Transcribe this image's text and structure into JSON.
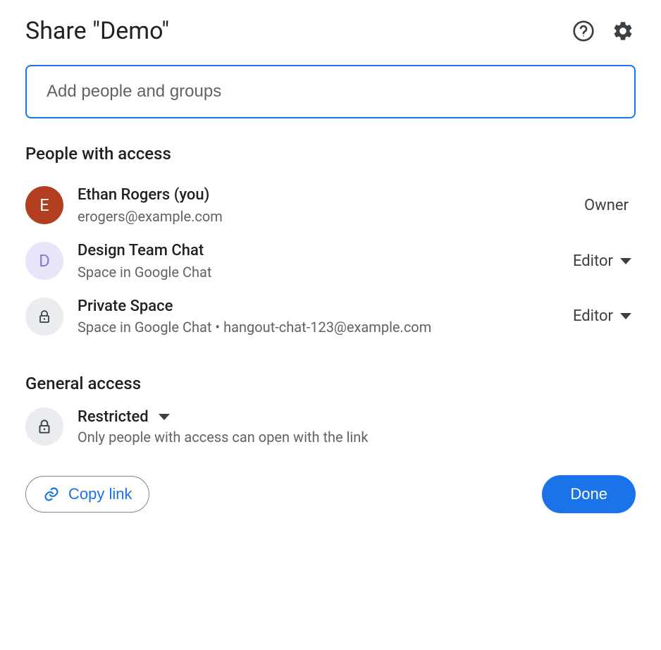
{
  "header": {
    "title": "Share \"Demo\""
  },
  "input": {
    "placeholder": "Add people and groups",
    "value": ""
  },
  "peopleSection": {
    "title": "People with access"
  },
  "people": [
    {
      "avatarLetter": "E",
      "name": "Ethan Rogers (you)",
      "sub": "erogers@example.com",
      "role": "Owner",
      "roleEditable": false,
      "avatarType": "red"
    },
    {
      "avatarLetter": "D",
      "name": "Design Team Chat",
      "sub": "Space in Google Chat",
      "role": "Editor",
      "roleEditable": true,
      "avatarType": "purple"
    },
    {
      "avatarLetter": "",
      "name": "Private Space",
      "sub": "Space in Google Chat • hangout-chat-123@example.com",
      "role": "Editor",
      "roleEditable": true,
      "avatarType": "lock"
    }
  ],
  "generalSection": {
    "title": "General access",
    "mode": "Restricted",
    "desc": "Only people with access can open with the link"
  },
  "footer": {
    "copyLink": "Copy link",
    "done": "Done"
  }
}
